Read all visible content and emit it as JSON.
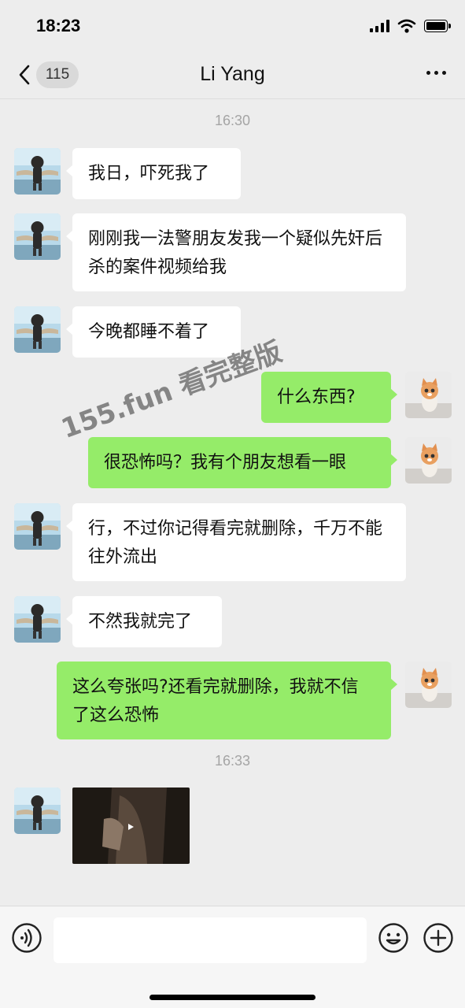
{
  "status_bar": {
    "time": "18:23"
  },
  "nav": {
    "back_count": "115",
    "title": "Li Yang"
  },
  "messages": [
    {
      "type": "time",
      "text": "16:30"
    },
    {
      "side": "left",
      "text": "我日，吓死我了"
    },
    {
      "side": "left",
      "text": "刚刚我一法警朋友发我一个疑似先奸后杀的案件视频给我"
    },
    {
      "side": "left",
      "text": "今晚都睡不着了"
    },
    {
      "side": "right",
      "text": "什么东西?"
    },
    {
      "side": "right",
      "text": "很恐怖吗？我有个朋友想看一眼"
    },
    {
      "side": "left",
      "text": "行，不过你记得看完就删除，千万不能往外流出"
    },
    {
      "side": "left",
      "text": "不然我就完了"
    },
    {
      "side": "right",
      "text": "这么夸张吗?还看完就删除，我就不信了这么恐怖"
    },
    {
      "type": "time",
      "text": "16:33"
    },
    {
      "side": "left",
      "type": "video"
    }
  ],
  "watermark": "155.fun 看完整版",
  "input": {
    "placeholder": ""
  },
  "icons": {
    "back": "chevron-left-icon",
    "more": "more-dots-icon",
    "voice": "voice-icon",
    "emoji": "emoji-icon",
    "plus": "plus-icon"
  },
  "colors": {
    "bubble_self": "#95ec69",
    "bubble_other": "#ffffff",
    "background": "#ededed"
  }
}
